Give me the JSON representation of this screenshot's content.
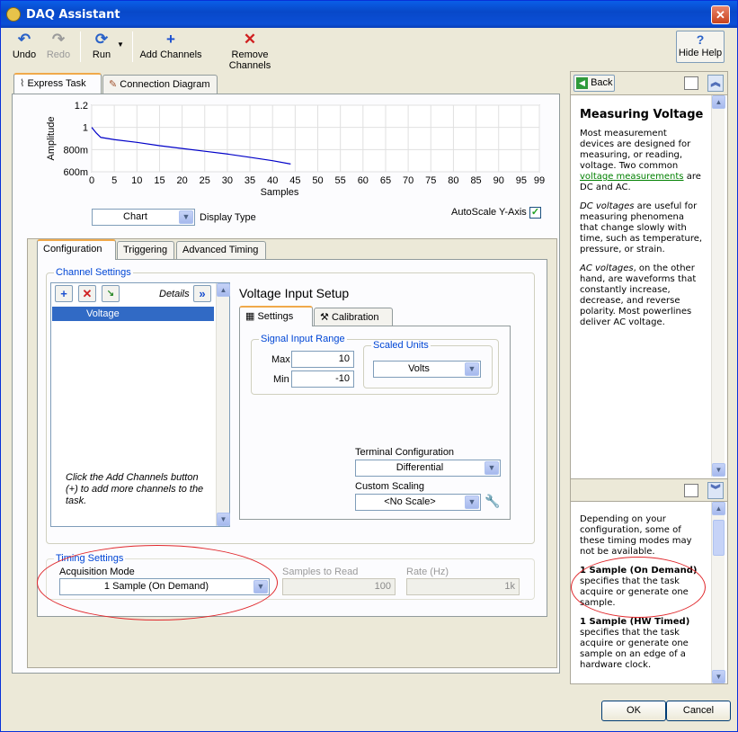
{
  "window": {
    "title": "DAQ Assistant",
    "close": "✕"
  },
  "toolbar": {
    "undo": "Undo",
    "redo": "Redo",
    "run": "Run",
    "add_channels": "Add Channels",
    "remove_channels": "Remove Channels",
    "hide_help": "Hide Help"
  },
  "tabs": {
    "express_task": "Express Task",
    "connection_diagram": "Connection Diagram"
  },
  "chart": {
    "display_type_value": "Chart",
    "display_type_label": "Display Type",
    "autoscale_label": "AutoScale Y-Axis",
    "autoscale_checked": true
  },
  "chart_data": {
    "type": "line",
    "xlabel": "Samples",
    "ylabel": "Amplitude",
    "xlim": [
      0,
      99
    ],
    "ylim": [
      0.6,
      1.2
    ],
    "x_ticks": [
      "0",
      "5",
      "10",
      "15",
      "20",
      "25",
      "30",
      "35",
      "40",
      "45",
      "50",
      "55",
      "60",
      "65",
      "70",
      "75",
      "80",
      "85",
      "90",
      "95",
      "99"
    ],
    "y_ticks": [
      {
        "v": 1.2,
        "label": "1.2"
      },
      {
        "v": 1.0,
        "label": "1"
      },
      {
        "v": 0.8,
        "label": "800m"
      },
      {
        "v": 0.6,
        "label": "600m"
      }
    ],
    "series": [
      {
        "color": "#0000c8",
        "x": [
          0,
          1,
          2,
          5,
          10,
          15,
          20,
          25,
          30,
          35,
          40,
          44
        ],
        "y": [
          1.0,
          0.95,
          0.91,
          0.89,
          0.865,
          0.835,
          0.81,
          0.785,
          0.76,
          0.73,
          0.7,
          0.67
        ]
      }
    ]
  },
  "config_tabs": {
    "configuration": "Configuration",
    "triggering": "Triggering",
    "advanced_timing": "Advanced Timing"
  },
  "channel_settings": {
    "title": "Channel Settings",
    "details": "Details",
    "details_btn": "»",
    "channels": [
      "Voltage"
    ],
    "hint": "Click the Add Channels button (+) to add more channels to the task."
  },
  "voltage_setup": {
    "title": "Voltage Input Setup",
    "tab_settings": "Settings",
    "tab_calibration": "Calibration",
    "signal_range_title": "Signal Input Range",
    "max_label": "Max",
    "max_value": "10",
    "min_label": "Min",
    "min_value": "-10",
    "scaled_units_title": "Scaled Units",
    "scaled_units_value": "Volts",
    "terminal_config_label": "Terminal Configuration",
    "terminal_config_value": "Differential",
    "custom_scaling_label": "Custom Scaling",
    "custom_scaling_value": "<No Scale>"
  },
  "timing": {
    "title": "Timing Settings",
    "acq_mode_label": "Acquisition Mode",
    "acq_mode_value": "1 Sample (On Demand)",
    "samples_label": "Samples to Read",
    "samples_value": "100",
    "rate_label": "Rate (Hz)",
    "rate_value": "1k"
  },
  "help": {
    "back": "Back",
    "heading": "Measuring Voltage",
    "p1_a": "Most measurement devices are designed for measuring, or reading, voltage. Two common ",
    "p1_link": "voltage measurements",
    "p1_b": " are DC and AC.",
    "p2_em": "DC voltages",
    "p2": " are useful for measuring phenomena that change slowly with time, such as temperature, pressure, or strain.",
    "p3_em": "AC voltages",
    "p3": ", on the other hand, are waveforms that constantly increase, decrease, and reverse polarity. Most powerlines deliver AC voltage.",
    "b1": "Depending on your configuration, some of these timing modes may not be available.",
    "b2_bold": "1 Sample (On Demand)",
    "b2": " specifies that the task acquire or generate one sample.",
    "b3_bold": "1 Sample (HW Timed)",
    "b3": " specifies that the task acquire or generate one sample on an edge of a hardware clock."
  },
  "buttons": {
    "ok": "OK",
    "cancel": "Cancel"
  }
}
